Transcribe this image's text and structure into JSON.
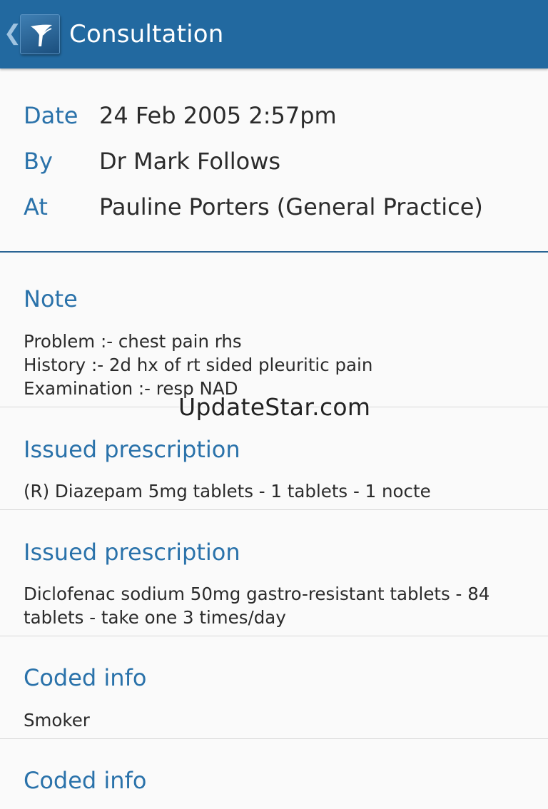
{
  "header": {
    "title": "Consultation",
    "back_icon": "chevron-left-icon",
    "logo_icon": "app-logo-icon",
    "background_color": "#2269a0"
  },
  "details": {
    "date_label": "Date",
    "date_value": "24 Feb 2005 2:57pm",
    "by_label": "By",
    "by_value": "Dr Mark Follows",
    "at_label": "At",
    "at_value": "Pauline Porters (General Practice)"
  },
  "sections": [
    {
      "title": "Note",
      "lines": [
        "Problem :- chest pain rhs",
        "History :- 2d hx of rt sided pleuritic pain",
        "Examination :- resp NAD"
      ]
    },
    {
      "title": "Issued prescription",
      "lines": [
        "(R) Diazepam 5mg tablets - 1 tablets - 1 nocte"
      ]
    },
    {
      "title": "Issued prescription",
      "lines": [
        "Diclofenac sodium 50mg gastro-resistant tablets - 84",
        "tablets - take one 3 times/day"
      ]
    },
    {
      "title": "Coded info",
      "lines": [
        "Smoker"
      ]
    },
    {
      "title": "Coded info",
      "lines": []
    }
  ],
  "watermark": "UpdateStar.com",
  "colors": {
    "accent": "#2a72aa",
    "divider": "#2a6494",
    "text": "#2b2b2b"
  }
}
